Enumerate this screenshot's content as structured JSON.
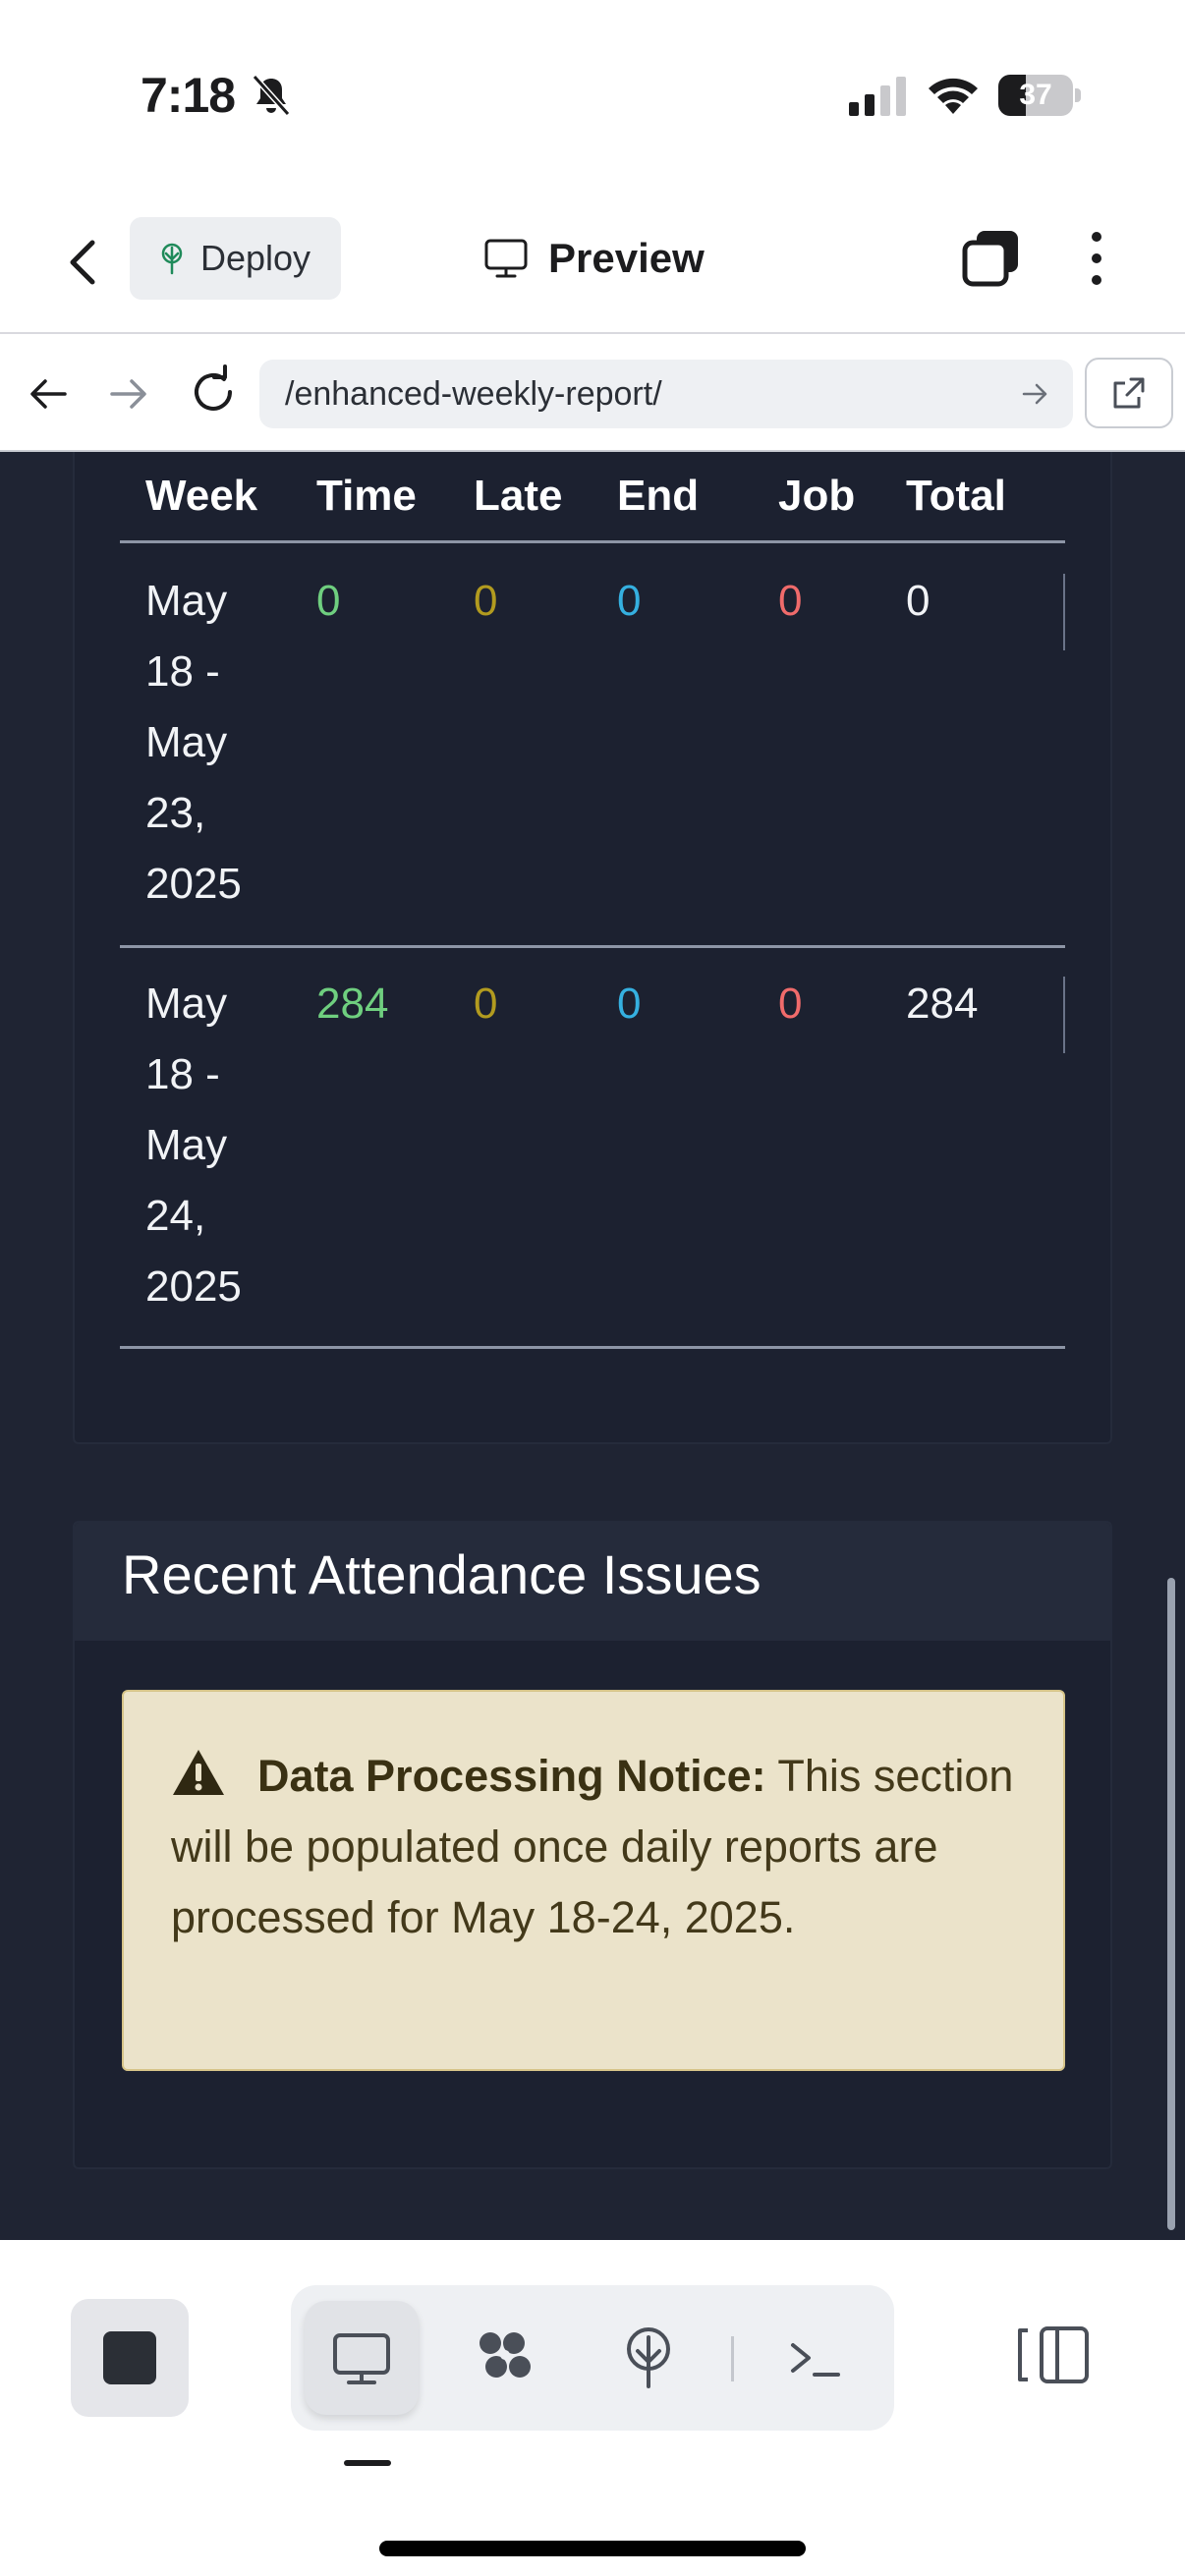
{
  "status_bar": {
    "time": "7:18",
    "battery": "37",
    "battery_level": 0.37,
    "icons": [
      "bell-slash-icon",
      "cellular-signal-icon",
      "wifi-icon",
      "battery-icon"
    ]
  },
  "header": {
    "deploy_label": "Deploy",
    "preview_label": "Preview",
    "icons": [
      "back-chevron-icon",
      "deploy-tree-icon",
      "monitor-icon",
      "tabs-icon",
      "more-vertical-icon"
    ]
  },
  "browser": {
    "url": "/enhanced-weekly-report/",
    "icons": [
      "arrow-left-icon",
      "arrow-right-icon",
      "reload-icon",
      "go-arrow-icon",
      "open-external-icon"
    ]
  },
  "table": {
    "columns": [
      "Week",
      "Time",
      "Late",
      "End",
      "Job",
      "Total"
    ],
    "rows": [
      {
        "week_lines": [
          "May",
          "18 -",
          "May",
          "23,",
          "2025"
        ],
        "time": "0",
        "late": "0",
        "end": "0",
        "job": "0",
        "total": "0"
      },
      {
        "week_lines": [
          "May",
          "18 -",
          "May",
          "24,",
          "2025"
        ],
        "time": "284",
        "late": "0",
        "end": "0",
        "job": "0",
        "total": "284"
      }
    ]
  },
  "attendance": {
    "title": "Recent Attendance Issues",
    "notice_label": "Data Processing Notice:",
    "notice_text": " This section will be populated once daily reports are processed for May 18-24, 2025."
  },
  "colors": {
    "content_bg": "#1f2433",
    "time_green": "#6fcf7f",
    "late_olive": "#b29b1f",
    "end_blue": "#35b0e0",
    "job_red": "#f06b6b",
    "notice_bg": "#ebe3ca"
  },
  "toolbar": {
    "icons": [
      "stop-icon",
      "preview-monitor-icon",
      "app-grid-icon",
      "deploy-tree-icon",
      "terminal-icon",
      "split-view-icon"
    ],
    "active": "preview-monitor-icon"
  }
}
